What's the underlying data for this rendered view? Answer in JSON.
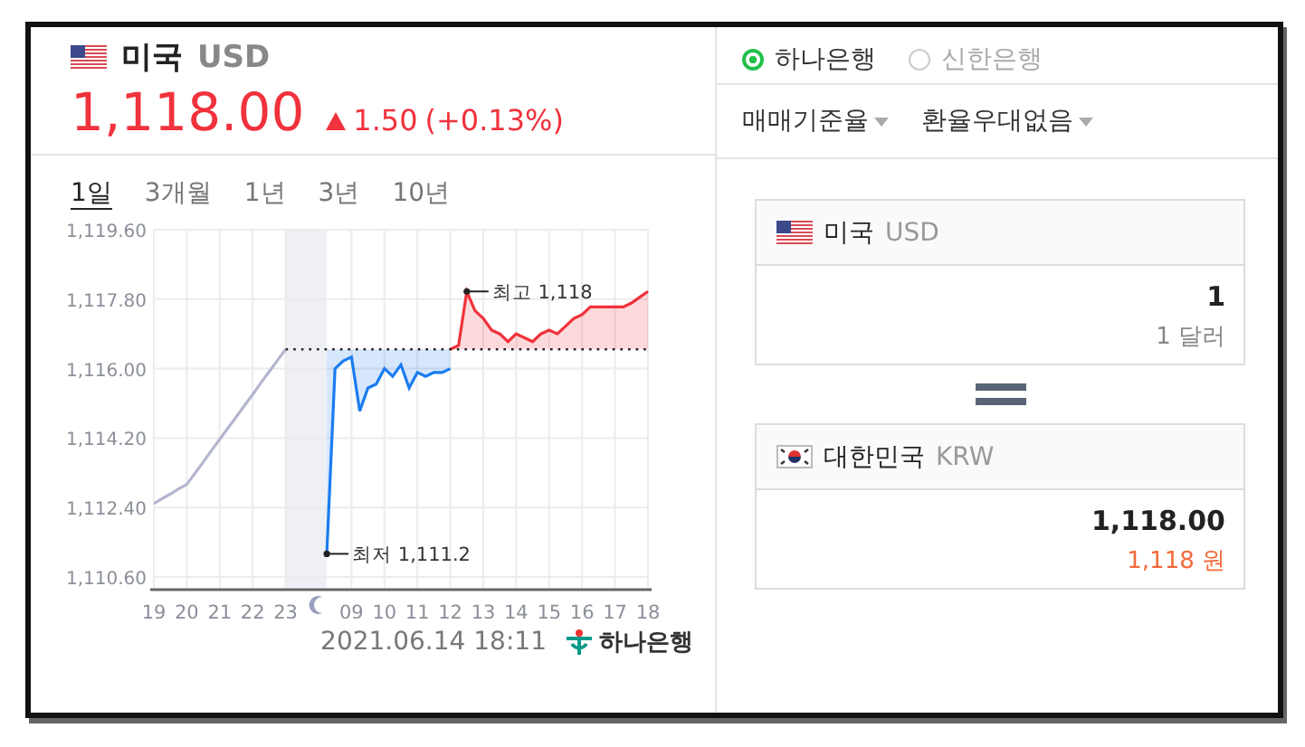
{
  "quote": {
    "country": "미국",
    "code": "USD",
    "price": "1,118.00",
    "up": true,
    "change": "1.50",
    "change_pct": "(+0.13%)"
  },
  "periods": [
    {
      "label": "1일",
      "selected": true
    },
    {
      "label": "3개월",
      "selected": false
    },
    {
      "label": "1년",
      "selected": false
    },
    {
      "label": "3년",
      "selected": false
    },
    {
      "label": "10년",
      "selected": false
    }
  ],
  "chart_data": {
    "type": "line",
    "grid": true,
    "ylim": [
      1110.6,
      1119.6
    ],
    "yticks": [
      {
        "value": 1119.6,
        "label": "1,119.60"
      },
      {
        "value": 1117.8,
        "label": "1,117.80"
      },
      {
        "value": 1116.0,
        "label": "1,116.00"
      },
      {
        "value": 1114.2,
        "label": "1,114.20"
      },
      {
        "value": 1112.4,
        "label": "1,112.40"
      },
      {
        "value": 1110.6,
        "label": "1,110.60"
      }
    ],
    "categories": [
      "19",
      null,
      null,
      null,
      "20",
      null,
      null,
      null,
      "21",
      null,
      null,
      null,
      "22",
      null,
      null,
      null,
      "23",
      null,
      null,
      null,
      null,
      null,
      null,
      null,
      "09",
      null,
      null,
      null,
      "10",
      null,
      null,
      null,
      "11",
      null,
      null,
      null,
      "12",
      null,
      null,
      null,
      "13",
      null,
      null,
      null,
      "14",
      null,
      null,
      null,
      "15",
      null,
      null,
      null,
      "16",
      null,
      null,
      null,
      "17",
      null,
      null,
      null,
      "18"
    ],
    "series": [
      {
        "color": "#b4b6d0",
        "values": [
          1112.5,
          1112.63,
          1112.75,
          1112.88,
          1113.0,
          1113.29,
          1113.58,
          1113.88,
          1114.17,
          1114.46,
          1114.75,
          1115.04,
          1115.33,
          1115.63,
          1115.92,
          1116.21,
          1116.5,
          null,
          null,
          null,
          null,
          null,
          null,
          null,
          null,
          null,
          null,
          null,
          null,
          null,
          null,
          null,
          null,
          null,
          null,
          null,
          null,
          null,
          null,
          null,
          null,
          null,
          null,
          null,
          null,
          null,
          null,
          null,
          null,
          null,
          null,
          null,
          null,
          null,
          null,
          null,
          null,
          null,
          null,
          null,
          null
        ]
      },
      {
        "color": "#1a7cf0",
        "values": [
          null,
          null,
          null,
          null,
          null,
          null,
          null,
          null,
          null,
          null,
          null,
          null,
          null,
          null,
          null,
          null,
          null,
          null,
          null,
          null,
          null,
          1111.2,
          1116.0,
          1116.2,
          1116.3,
          1114.9,
          1115.5,
          1115.6,
          1116.0,
          1115.8,
          1116.1,
          1115.5,
          1115.9,
          1115.8,
          1115.9,
          1115.9,
          1116.0,
          null,
          null,
          null,
          null,
          null,
          null,
          null,
          null,
          null,
          null,
          null,
          null,
          null,
          null,
          null,
          null,
          null,
          null,
          null,
          null,
          null,
          null,
          null,
          null
        ]
      },
      {
        "color": "#f0323c",
        "values": [
          null,
          null,
          null,
          null,
          null,
          null,
          null,
          null,
          null,
          null,
          null,
          null,
          null,
          null,
          null,
          null,
          null,
          null,
          null,
          null,
          null,
          null,
          null,
          null,
          null,
          null,
          null,
          null,
          null,
          null,
          null,
          null,
          null,
          null,
          null,
          null,
          1116.5,
          1116.6,
          1118.0,
          1117.5,
          1117.3,
          1117.0,
          1116.9,
          1116.7,
          1116.9,
          1116.8,
          1116.7,
          1116.9,
          1117.0,
          1116.9,
          1117.1,
          1117.3,
          1117.4,
          1117.6,
          1117.6,
          1117.6,
          1117.6,
          1117.6,
          1117.7,
          1117.85,
          1118.0
        ]
      }
    ],
    "ref_lines": [
      {
        "axis": "y",
        "value": 1116.5
      }
    ],
    "annotations": [
      "최고 1,118",
      "최저 1,111.2"
    ]
  },
  "timestamp": "2021.06.14 18:11",
  "bank_logo": "하나은행",
  "banks": [
    {
      "label": "하나은행",
      "selected": true
    },
    {
      "label": "신한은행",
      "selected": false
    }
  ],
  "dropdowns": [
    {
      "label": "매매기준율"
    },
    {
      "label": "환율우대없음"
    }
  ],
  "converter": [
    {
      "kind": "source",
      "country": "미국",
      "code": "USD",
      "amount": "1",
      "unit": "1 달러"
    },
    {
      "kind": "result",
      "country": "대한민국",
      "code": "KRW",
      "amount": "1,118.00",
      "unit": "1,118 원"
    }
  ]
}
